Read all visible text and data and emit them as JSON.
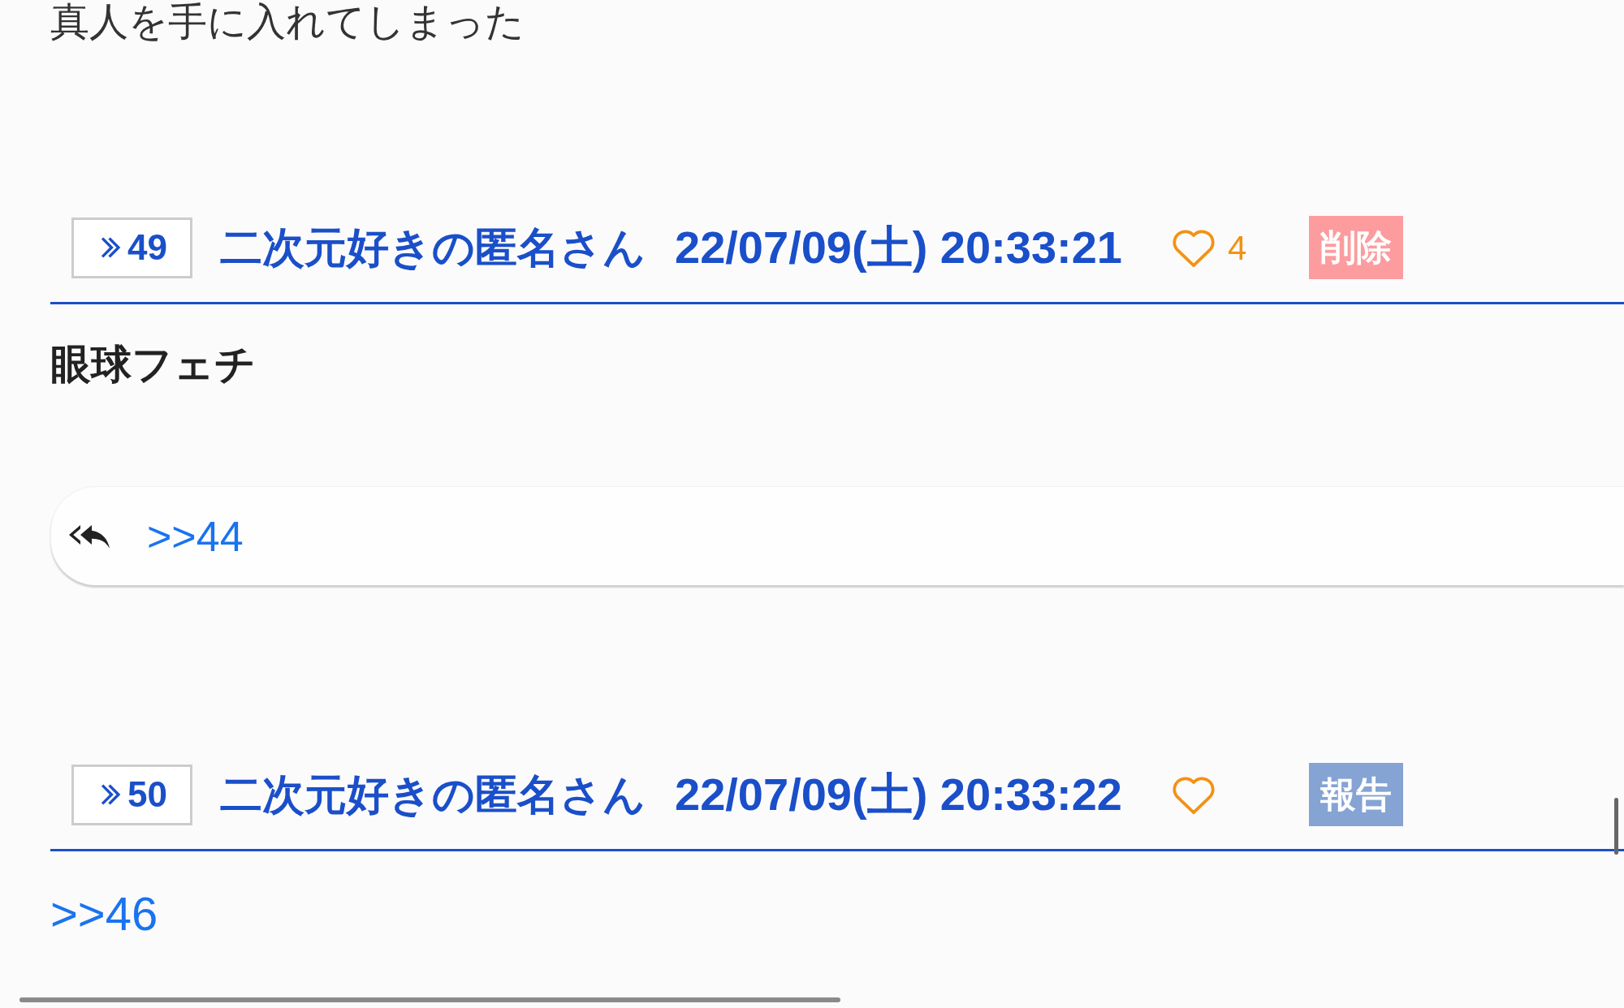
{
  "previous_post_text": "真人を手に入れてしまった",
  "posts": [
    {
      "number": "49",
      "name": "二次元好きの匿名さん",
      "date": "22/07/09(土) 20:33:21",
      "like_count": "4",
      "action": {
        "label": "削除",
        "kind": "delete"
      },
      "content": [
        {
          "kind": "text",
          "text": "眼球フェチ"
        },
        {
          "kind": "reply_ref",
          "text": ">>44"
        }
      ]
    },
    {
      "number": "50",
      "name": "二次元好きの匿名さん",
      "date": "22/07/09(土) 20:33:22",
      "action": {
        "label": "報告",
        "kind": "report"
      },
      "content": [
        {
          "kind": "anchor",
          "text": ">>46"
        }
      ]
    }
  ]
}
